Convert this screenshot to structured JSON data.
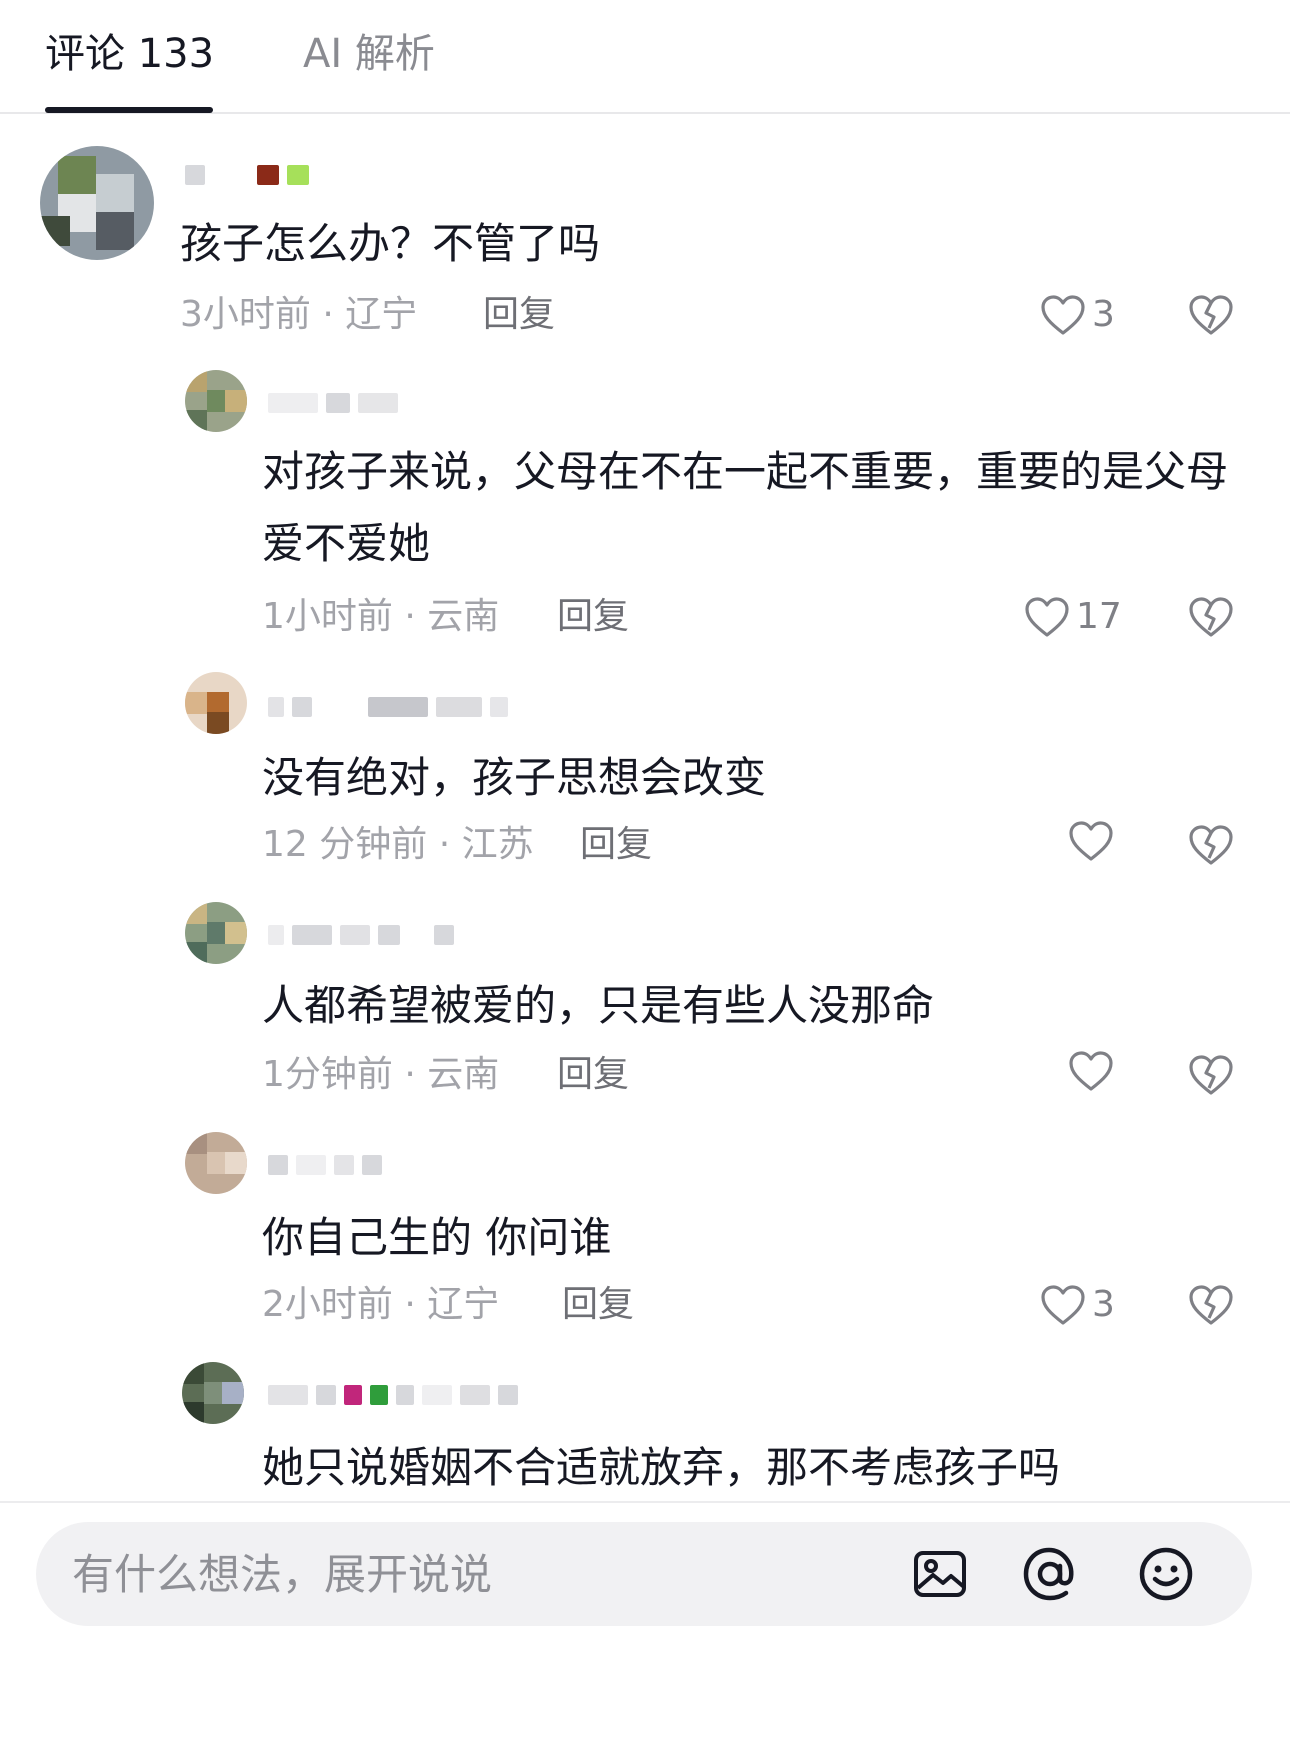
{
  "tabs": [
    {
      "label": "评论 133",
      "active": true
    },
    {
      "label": "AI 解析",
      "active": false
    }
  ],
  "comments": [
    {
      "text": "孩子怎么办？不管了吗",
      "meta": "3小时前 · 辽宁",
      "reply": "回复",
      "likes": "3"
    },
    {
      "text": "对孩子来说，父母在不在一起不重要，重要的是父母爱不爱她",
      "meta": "1小时前 · 云南",
      "reply": "回复",
      "likes": "17"
    },
    {
      "text": "没有绝对，孩子思想会改变",
      "meta": "12 分钟前 · 江苏",
      "reply": "回复",
      "likes": ""
    },
    {
      "text": "人都希望被爱的，只是有些人没那命",
      "meta": "1分钟前 · 云南",
      "reply": "回复",
      "likes": ""
    },
    {
      "text": "你自己生的 你问谁",
      "meta": "2小时前 · 辽宁",
      "reply": "回复",
      "likes": "3"
    },
    {
      "text": "她只说婚姻不合适就放弃，那不考虑孩子吗",
      "meta": "",
      "reply": "",
      "likes": ""
    }
  ],
  "composer": {
    "placeholder": "有什么想法，展开说说",
    "icons": [
      "image-icon",
      "mention-icon",
      "emoji-icon"
    ]
  },
  "colors": {
    "text": "#161823",
    "meta": "#a2a3a9",
    "reply": "#6e6f75",
    "icon": "#7f8086",
    "composer_bg": "#f1f1f3"
  }
}
